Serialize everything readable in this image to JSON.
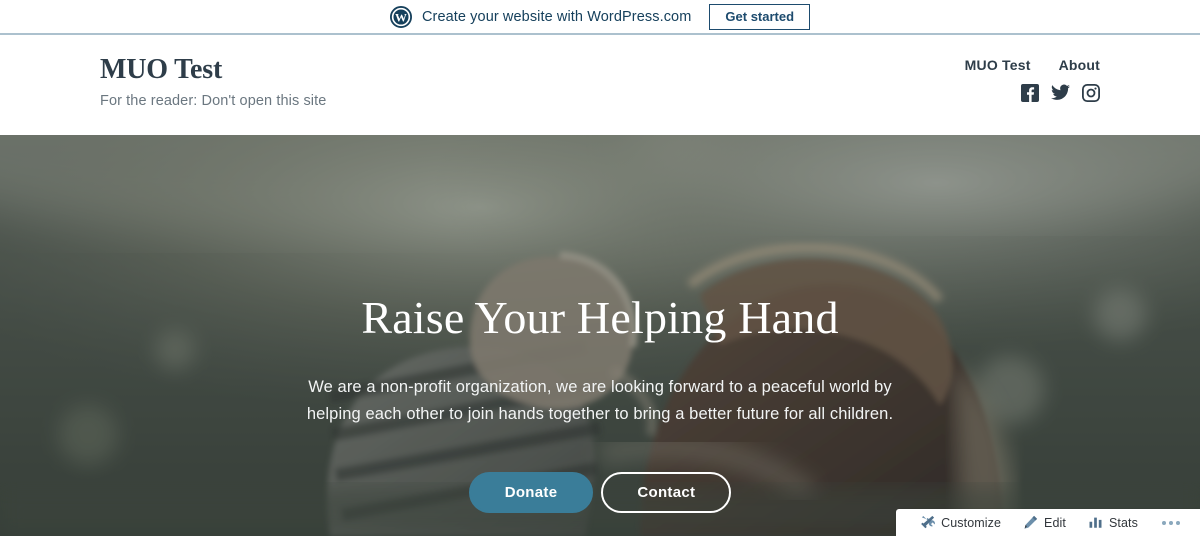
{
  "promo_banner": {
    "logo_icon": "wordpress-logo-icon",
    "text": "Create your website with WordPress.com",
    "cta_label": "Get started"
  },
  "site_header": {
    "title": "MUO Test",
    "tagline": "For the reader: Don't open this site",
    "nav": [
      {
        "label": "MUO Test"
      },
      {
        "label": "About"
      }
    ],
    "social": [
      {
        "name": "facebook-icon",
        "label": "Facebook"
      },
      {
        "name": "twitter-icon",
        "label": "Twitter"
      },
      {
        "name": "instagram-icon",
        "label": "Instagram"
      }
    ]
  },
  "hero": {
    "title": "Raise Your Helping Hand",
    "text": "We are a non-profit organization, we are looking forward to a peaceful world by helping each other to join hands together to bring a better future for all children.",
    "primary_button": "Donate",
    "secondary_button": "Contact"
  },
  "admin_bar": {
    "items": [
      {
        "icon": "customize-tools-icon",
        "label": "Customize"
      },
      {
        "icon": "edit-pencil-icon",
        "label": "Edit"
      },
      {
        "icon": "stats-bar-chart-icon",
        "label": "Stats"
      }
    ],
    "more_icon": "ellipsis-icon"
  },
  "colors": {
    "banner_text": "#16405c",
    "banner_border": "#acc1ce",
    "title": "#2e3d49",
    "tagline": "#6b7780",
    "donate_button": "#3a7d99",
    "hero_overlay": "rgba(43,52,58,0.42)"
  }
}
